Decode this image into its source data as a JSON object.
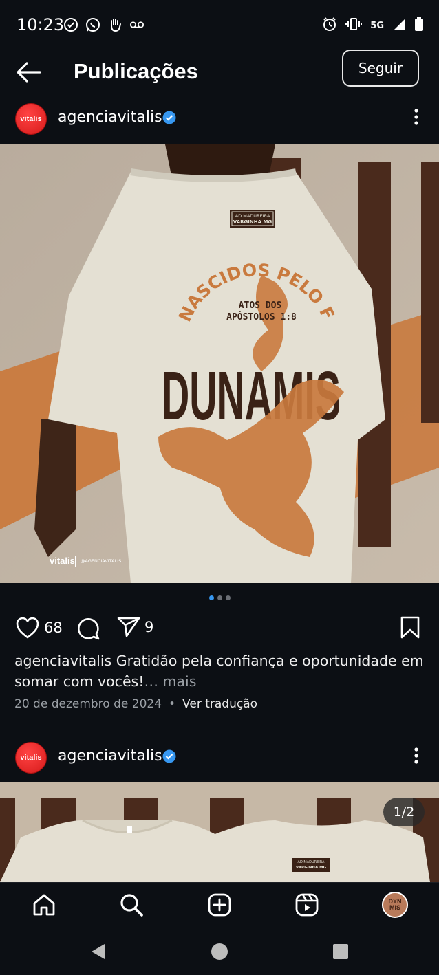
{
  "status_bar": {
    "time": "10:23",
    "left_icons": [
      "check-circle-icon",
      "whatsapp-icon",
      "hand-icon",
      "voicemail-icon"
    ],
    "network": "5G",
    "right_icons": [
      "alarm-icon",
      "vibrate-icon",
      "signal-icon",
      "battery-icon"
    ]
  },
  "header": {
    "title": "Publicações",
    "follow_label": "Seguir"
  },
  "post": {
    "avatar_text": "vitalis",
    "username": "agenciavitalis",
    "verified": true,
    "image": {
      "tag_line1": "AD MADUREIRA",
      "tag_line2": "VARGINHA MG",
      "arc_text": "NASCIDOS PELO FOGO",
      "verse_line1": "ATOS DOS",
      "verse_line2": "APÓSTOLOS 1:8",
      "main_word": "DUNAMIS",
      "brand": "vitalis",
      "handle": "@AGENCIAVITALIS"
    },
    "carousel": {
      "count": 3,
      "active": 0
    },
    "likes": "68",
    "shares": "9",
    "caption_user": "agenciavitalis",
    "caption_text": "Gratidão pela confiança e oportunidade em somar com vocês!",
    "caption_more": "… mais",
    "date": "20 de dezembro de 2024",
    "separator": "•",
    "translate_label": "Ver tradução"
  },
  "post2": {
    "avatar_text": "vitalis",
    "username": "agenciavitalis",
    "verified": true,
    "page_indicator": "1/2",
    "tag_line1": "AD MADUREIRA",
    "tag_line2": "VARGINHA MG"
  },
  "bottom_nav": {
    "items": [
      "home-icon",
      "search-icon",
      "create-icon",
      "reels-icon",
      "profile-avatar"
    ],
    "profile_text_line1": "DYN",
    "profile_text_line2": "MIS"
  },
  "colors": {
    "background": "#0c0f14",
    "accent": "#3797f0",
    "brand_red": "#e02020",
    "orange": "#c97a3e",
    "brown": "#4a2a1c"
  }
}
